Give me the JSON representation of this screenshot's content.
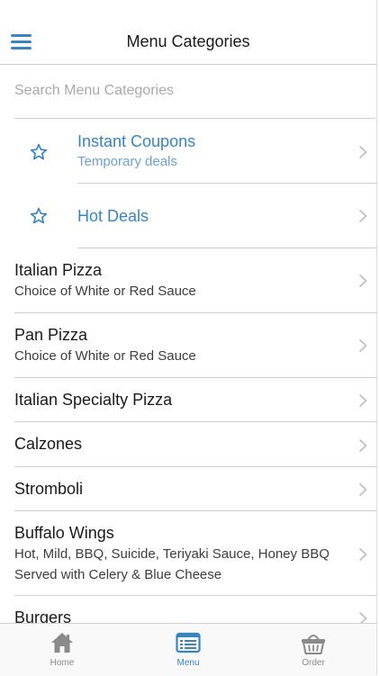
{
  "header": {
    "title": "Menu Categories",
    "menu_icon": "hamburger-menu-icon"
  },
  "search": {
    "placeholder": "Search Menu Categories",
    "value": ""
  },
  "promotions": [
    {
      "title": "Instant Coupons",
      "subtitle": "Temporary deals",
      "icon": "star-icon"
    },
    {
      "title": "Hot Deals",
      "icon": "star-icon"
    }
  ],
  "categories": [
    {
      "title": "Italian Pizza",
      "subtitle": "Choice of White or Red Sauce"
    },
    {
      "title": "Pan Pizza",
      "subtitle": "Choice of White or Red Sauce"
    },
    {
      "title": "Italian Specialty Pizza"
    },
    {
      "title": "Calzones"
    },
    {
      "title": "Stromboli"
    },
    {
      "title": "Buffalo Wings",
      "subtitle_lines": [
        "Hot, Mild, BBQ, Suicide, Teriyaki Sauce, Honey BBQ",
        "Served with Celery & Blue Cheese"
      ]
    },
    {
      "title": "Burgers"
    }
  ],
  "tabbar": {
    "tabs": [
      {
        "label": "Home",
        "icon": "home-icon",
        "active": false
      },
      {
        "label": "Menu",
        "icon": "menu-list-icon",
        "active": true
      },
      {
        "label": "Order",
        "icon": "basket-icon",
        "active": false
      }
    ]
  },
  "colors": {
    "accent": "#3a83c1",
    "promo_subtitle": "#6fa1cc",
    "separator": "#cfcfcf",
    "tab_inactive": "#8a8a8a"
  }
}
